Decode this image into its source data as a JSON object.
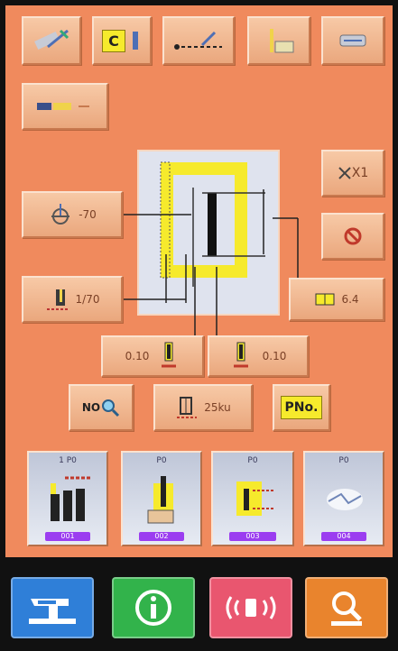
{
  "top_toolbar": {
    "icons": [
      "sewing-data-edit-icon",
      "clamp-c-icon",
      "stitch-feed-icon",
      "bobbin-thread-icon",
      "needle-cooler-icon",
      "display-switch-icon"
    ],
    "clamp_letter": "C"
  },
  "left_params": {
    "needle_angle_value": "-70",
    "feed_value": "1/70",
    "needle_angle_icon": "needle-angle-icon",
    "feed_icon": "feed-pitch-icon"
  },
  "right_params": {
    "multiplier_label": "X1",
    "cancel_icon": "cancel-icon",
    "width_value": "6.4"
  },
  "needle_params": {
    "left_value": "0.10",
    "right_value": "0.10"
  },
  "action_row": {
    "no_search_label": "NO",
    "speed_value": "25ku",
    "pno_label": "PNo."
  },
  "patterns": [
    {
      "name": "1 P0",
      "number": "001"
    },
    {
      "name": "P0",
      "number": "002"
    },
    {
      "name": "P0",
      "number": "003"
    },
    {
      "name": "P0",
      "number": "004"
    }
  ],
  "bottom_bar": {
    "colors": [
      "#2f7fd8",
      "#32b34b",
      "#e9566f",
      "#e9842d"
    ],
    "icons": [
      "sewing-machine-icon",
      "info-icon",
      "vibration-icon",
      "search-icon"
    ]
  }
}
